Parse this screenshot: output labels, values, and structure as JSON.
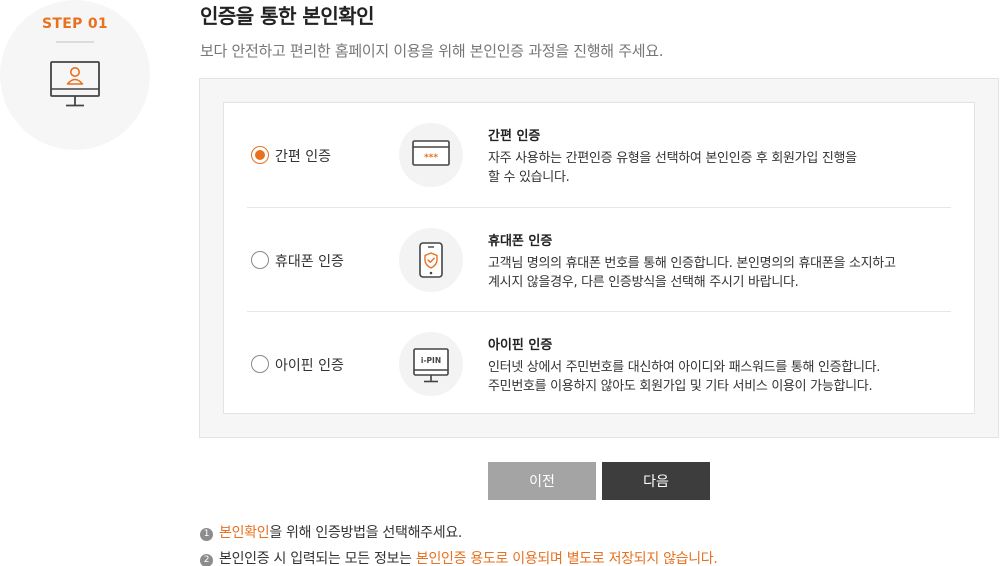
{
  "step": {
    "label": "STEP 01",
    "icon": "monitor-user-icon"
  },
  "page": {
    "title": "인증을 통한 본인확인",
    "description": "보다 안전하고 편리한 홈페이지 이용을 위해 본인인증 과정을 진행해 주세요."
  },
  "methods": [
    {
      "label": "간편 인증",
      "checked": true,
      "icon": "password-card-icon",
      "title": "간편 인증",
      "desc_line1": "자주 사용하는 간편인증 유형을 선택하여 본인인증 후 회원가입 진행을",
      "desc_line2": "할 수 있습니다."
    },
    {
      "label": "휴대폰 인증",
      "checked": false,
      "icon": "phone-shield-icon",
      "title": "휴대폰 인증",
      "desc_line1": "고객님 명의의 휴대폰 번호를 통해 인증합니다. 본인명의의 휴대폰을 소지하고",
      "desc_line2": "계시지 않을경우, 다른 인증방식을 선택해 주시기 바랍니다."
    },
    {
      "label": "아이핀 인증",
      "checked": false,
      "icon": "ipin-monitor-icon",
      "icon_text": "i-PIN",
      "title": "아이핀 인증",
      "desc_line1": "인터넷 상에서 주민번호를 대신하여 아이디와 패스워드를 통해 인증합니다.",
      "desc_line2": "주민번호를 이용하지 않아도 회원가입 및 기타 서비스 이용이 가능합니다."
    }
  ],
  "buttons": {
    "prev": "이전",
    "next": "다음"
  },
  "notes": [
    {
      "num": "1",
      "highlight": "본인확인",
      "text": "을 위해 인증방법을 선택해주세요."
    },
    {
      "num": "2",
      "text": "본인인증 시 입력되는 모든 정보는 ",
      "highlight": "본인인증 용도로 이용되며 별도로 저장되지 않습니다."
    }
  ],
  "colors": {
    "accent": "#e8711f",
    "prev_button": "#a4a4a4",
    "next_button": "#3d3d3d"
  }
}
